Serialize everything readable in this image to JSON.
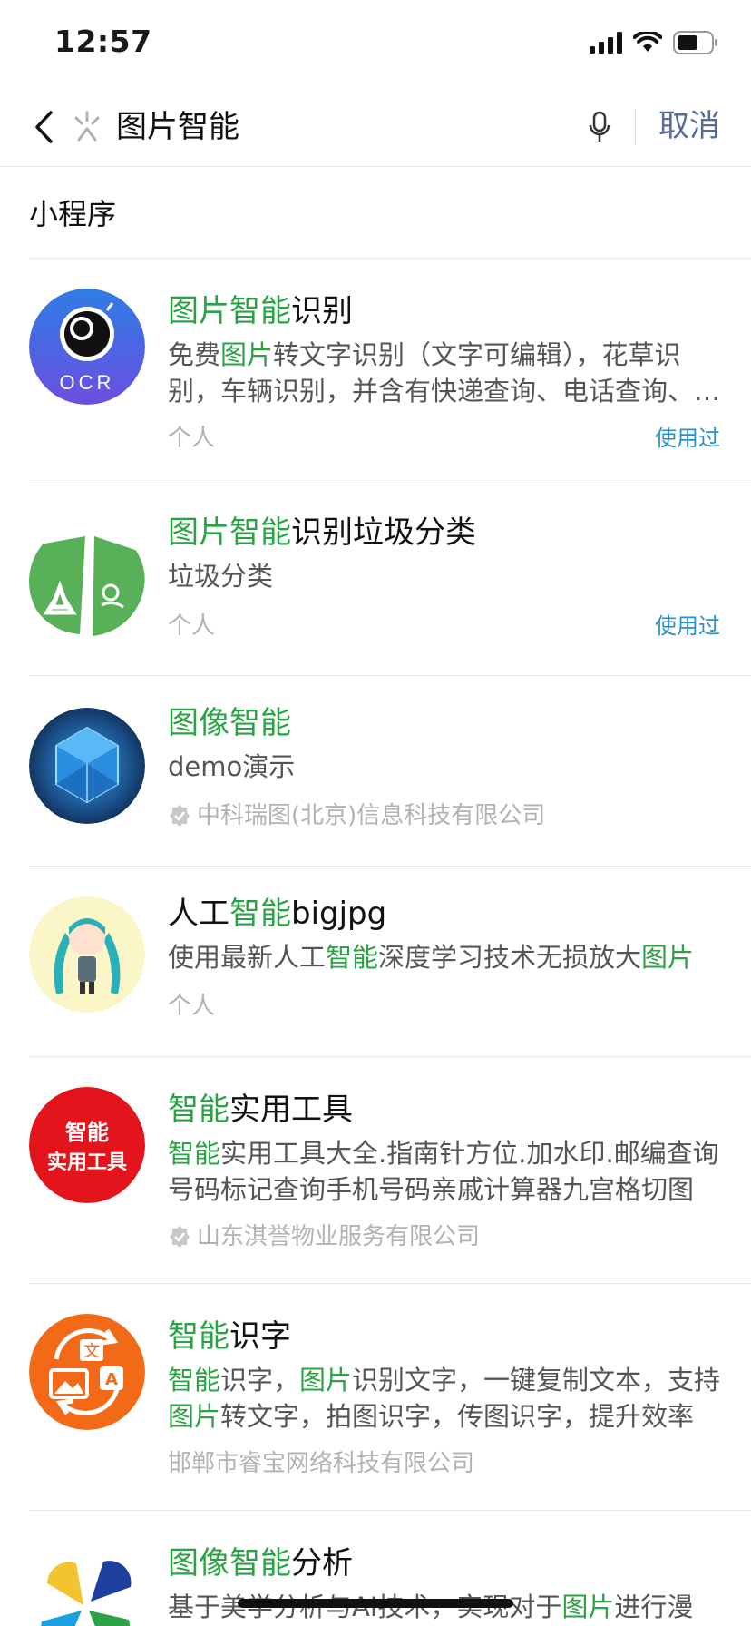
{
  "status_bar": {
    "time": "12:57"
  },
  "search": {
    "query": "图片智能",
    "cancel_label": "取消"
  },
  "section": {
    "title": "小程序"
  },
  "results": [
    {
      "title_parts": [
        {
          "t": "图片智能",
          "hl": true
        },
        {
          "t": "识别",
          "hl": false
        }
      ],
      "desc_parts": [
        {
          "t": "免费",
          "hl": false
        },
        {
          "t": "图片",
          "hl": true
        },
        {
          "t": "转文字识别（文字可编辑），花草识别，车辆识别，并含有快递查询、电话查询、天气查询等",
          "hl": false
        }
      ],
      "meta": "个人",
      "verified": false,
      "used_label": "使用过",
      "icon_text": "OCR"
    },
    {
      "title_parts": [
        {
          "t": "图片智能",
          "hl": true
        },
        {
          "t": "识别垃圾分类",
          "hl": false
        }
      ],
      "desc_parts": [
        {
          "t": "垃圾分类",
          "hl": false
        }
      ],
      "meta": "个人",
      "verified": false,
      "used_label": "使用过"
    },
    {
      "title_parts": [
        {
          "t": "图像智能",
          "hl": true
        }
      ],
      "desc_parts": [
        {
          "t": "demo演示",
          "hl": false
        }
      ],
      "meta": "中科瑞图(北京)信息科技有限公司",
      "verified": true
    },
    {
      "title_parts": [
        {
          "t": "人工",
          "hl": false
        },
        {
          "t": "智能",
          "hl": true
        },
        {
          "t": "bigjpg",
          "hl": false
        }
      ],
      "desc_parts": [
        {
          "t": "使用最新人工",
          "hl": false
        },
        {
          "t": "智能",
          "hl": true
        },
        {
          "t": "深度学习技术无损放大",
          "hl": false
        },
        {
          "t": "图片",
          "hl": true
        }
      ],
      "meta": "个人",
      "verified": false
    },
    {
      "title_parts": [
        {
          "t": "智能",
          "hl": true
        },
        {
          "t": "实用工具",
          "hl": false
        }
      ],
      "desc_parts": [
        {
          "t": "智能",
          "hl": true
        },
        {
          "t": "实用工具大全.指南针方位.加水印.邮编查询号码标记查询手机号码亲戚计算器九宫格切图",
          "hl": false
        }
      ],
      "meta": "山东淇誉物业服务有限公司",
      "verified": true,
      "icon_text_1": "智能",
      "icon_text_2": "实用工具"
    },
    {
      "title_parts": [
        {
          "t": "智能",
          "hl": true
        },
        {
          "t": "识字",
          "hl": false
        }
      ],
      "desc_parts": [
        {
          "t": "智能",
          "hl": true
        },
        {
          "t": "识字，",
          "hl": false
        },
        {
          "t": "图片",
          "hl": true
        },
        {
          "t": "识别文字，一键复制文本，支持",
          "hl": false
        },
        {
          "t": "图片",
          "hl": true
        },
        {
          "t": "转文字，拍图识字，传图识字，提升效率",
          "hl": false
        }
      ],
      "meta": "邯郸市睿宝网络科技有限公司",
      "verified": false,
      "icon_text_1": "文",
      "icon_text_2": "A"
    },
    {
      "title_parts": [
        {
          "t": "图像智能",
          "hl": true
        },
        {
          "t": "分析",
          "hl": false
        }
      ],
      "desc_parts": [
        {
          "t": "基于美学分析与AI技术，实现对于",
          "hl": false
        },
        {
          "t": "图片",
          "hl": true
        },
        {
          "t": "进行漫",
          "hl": false
        }
      ],
      "meta": "",
      "verified": false
    }
  ],
  "colors": {
    "highlight": "#2ba245",
    "link": "#576b95",
    "used": "#2a90c8"
  }
}
